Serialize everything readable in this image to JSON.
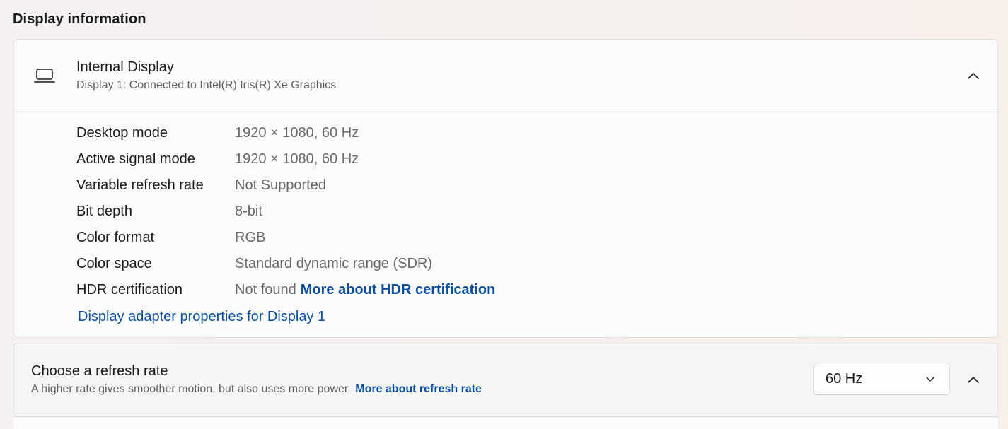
{
  "section_title": "Display information",
  "display": {
    "title": "Internal Display",
    "subtitle": "Display 1: Connected to Intel(R) Iris(R) Xe Graphics",
    "icon": "laptop-icon",
    "expanded": true,
    "details": [
      {
        "label": "Desktop mode",
        "value": "1920 × 1080, 60 Hz"
      },
      {
        "label": "Active signal mode",
        "value": "1920 × 1080, 60 Hz"
      },
      {
        "label": "Variable refresh rate",
        "value": "Not Supported"
      },
      {
        "label": "Bit depth",
        "value": "8-bit"
      },
      {
        "label": "Color format",
        "value": "RGB"
      },
      {
        "label": "Color space",
        "value": "Standard dynamic range (SDR)"
      },
      {
        "label": "HDR certification",
        "value": "Not found",
        "link": "More about HDR certification"
      }
    ],
    "adapter_link": "Display adapter properties for Display 1"
  },
  "refresh": {
    "title": "Choose a refresh rate",
    "subtitle": "A higher rate gives smoother motion, but also uses more power",
    "link": "More about refresh rate",
    "selected": "60 Hz"
  },
  "colors": {
    "accent_link": "#0b4f9e",
    "card_background": "#fbfbfa",
    "secondary_text": "#676767"
  }
}
